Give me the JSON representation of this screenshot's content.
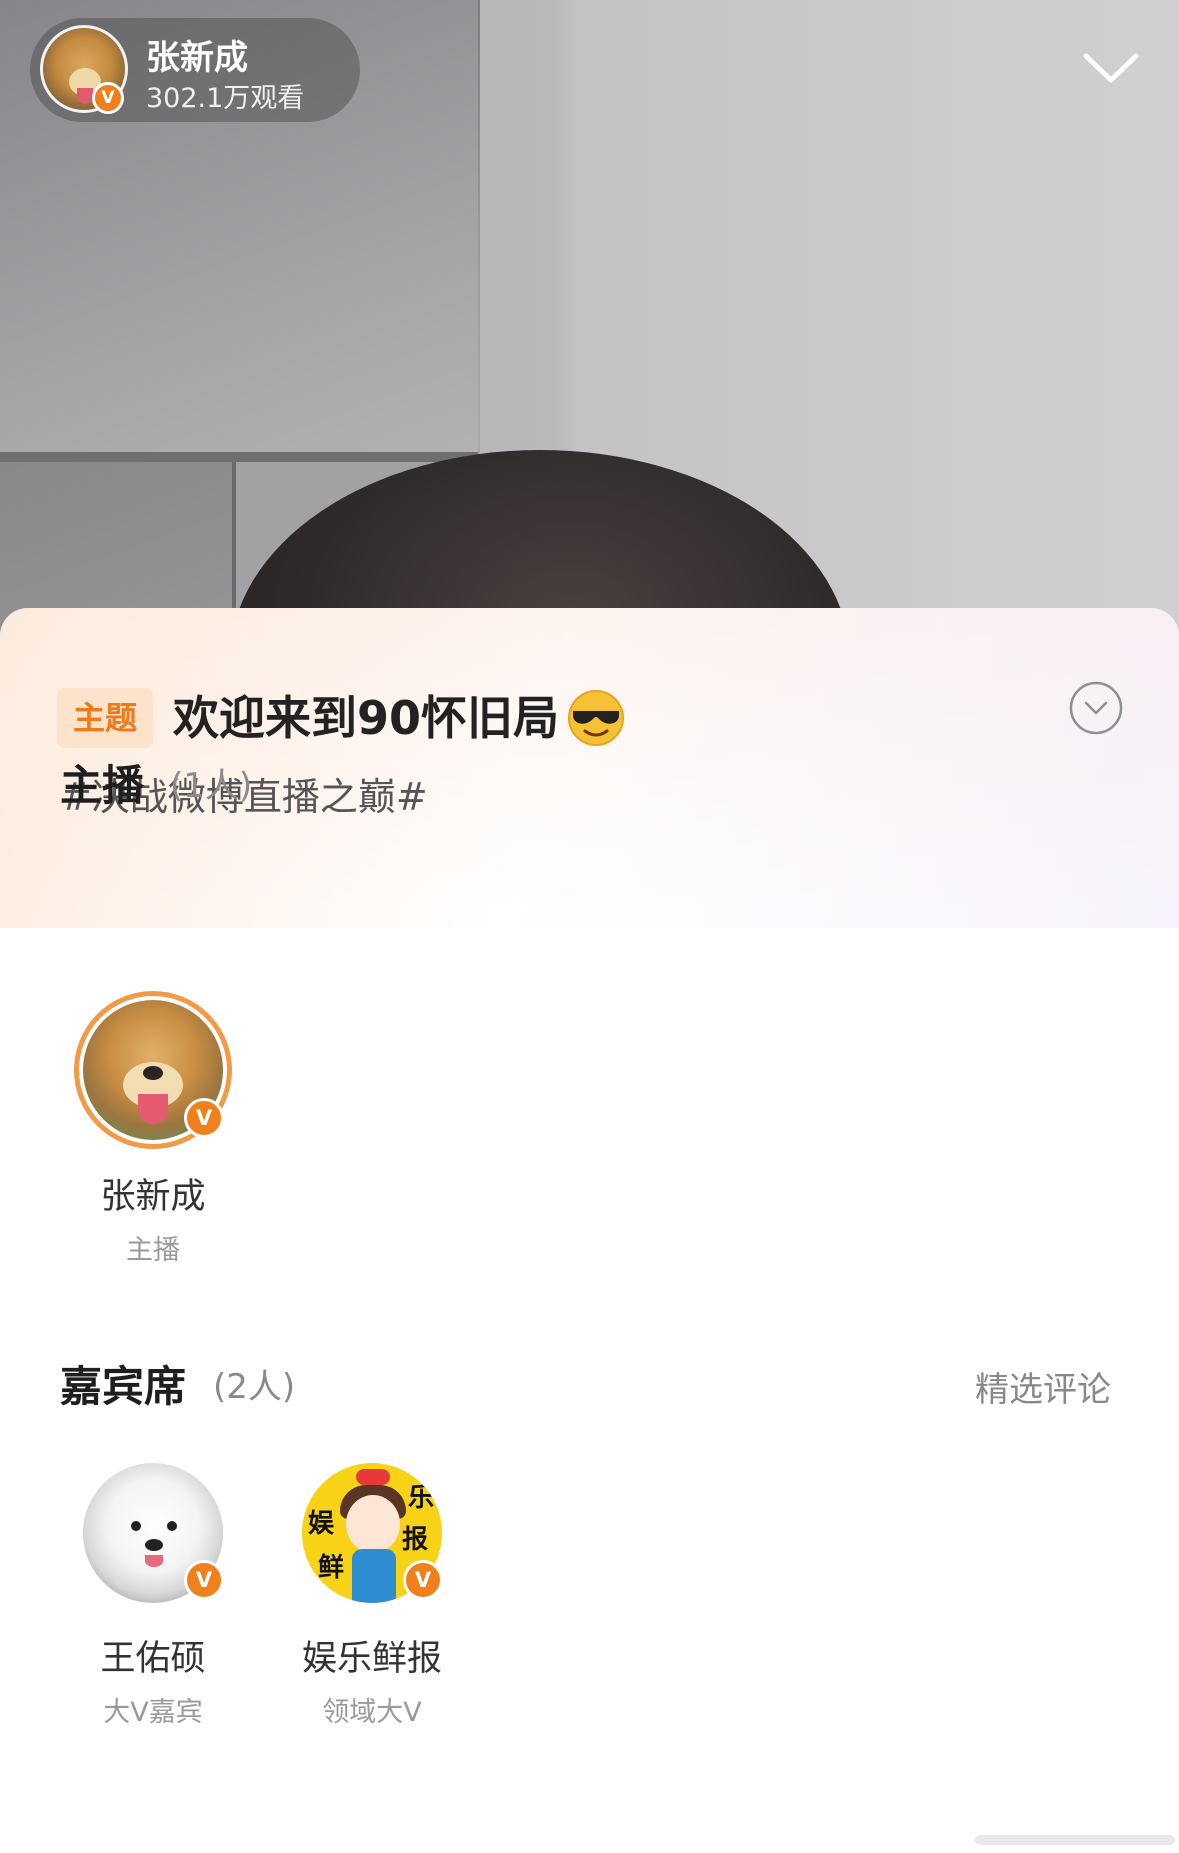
{
  "live": {
    "host_name": "张新成",
    "viewers": "302.1万观看",
    "verified_badge": "V"
  },
  "panel": {
    "topic_tag": "主题",
    "topic_title": "欢迎来到90怀旧局",
    "topic_emoji": "😎",
    "hashtag": "#决战微博直播之巅#"
  },
  "anchors": {
    "title": "主播",
    "count": "(1人)",
    "items": [
      {
        "name": "张新成",
        "role": "主播",
        "badge": "V"
      }
    ]
  },
  "guests": {
    "title": "嘉宾席",
    "count": "(2人)",
    "featured_comments": "精选评论",
    "items": [
      {
        "name": "王佑硕",
        "role": "大V嘉宾",
        "badge": "V"
      },
      {
        "name": "娱乐鲜报",
        "role": "领域大V",
        "badge": "V",
        "logo_chars": [
          "娱",
          "乐",
          "鲜",
          "报"
        ]
      }
    ]
  },
  "colors": {
    "accent_orange": "#f0801c",
    "tag_bg": "#fde2cc",
    "tag_text": "#f07a1a"
  }
}
